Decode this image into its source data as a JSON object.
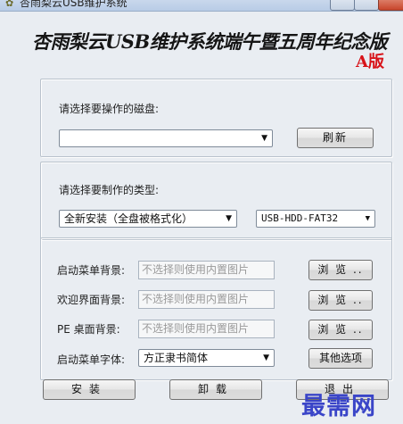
{
  "window": {
    "title": "杏雨梨云USB维护系统",
    "icon": "app-icon"
  },
  "banner": {
    "title": "杏雨梨云USB维护系统端午暨五周年纪念版",
    "edition": "A版"
  },
  "disk_group": {
    "prompt": "请选择要操作的磁盘:",
    "disk_select_value": "",
    "refresh_label": "刷新"
  },
  "type_group": {
    "prompt": "请选择要制作的类型:",
    "install_type_value": "全新安装（全盘被格式化）",
    "mode_value": "USB-HDD-FAT32"
  },
  "background_group": {
    "boot_menu_bg_label": "启动菜单背景:",
    "boot_menu_bg_placeholder": "不选择则使用内置图片",
    "welcome_bg_label": "欢迎界面背景:",
    "welcome_bg_placeholder": "不选择则使用内置图片",
    "pe_bg_label": "PE 桌面背景:",
    "pe_bg_placeholder": "不选择则使用内置图片",
    "browse_label": "浏 览 ..",
    "font_label": "启动菜单字体:",
    "font_value": "方正隶书简体",
    "other_options_label": "其他选项"
  },
  "actions": {
    "install_label": "安装",
    "uninstall_label": "卸载",
    "exit_label": "退出"
  },
  "watermark": {
    "text": "最需网"
  }
}
